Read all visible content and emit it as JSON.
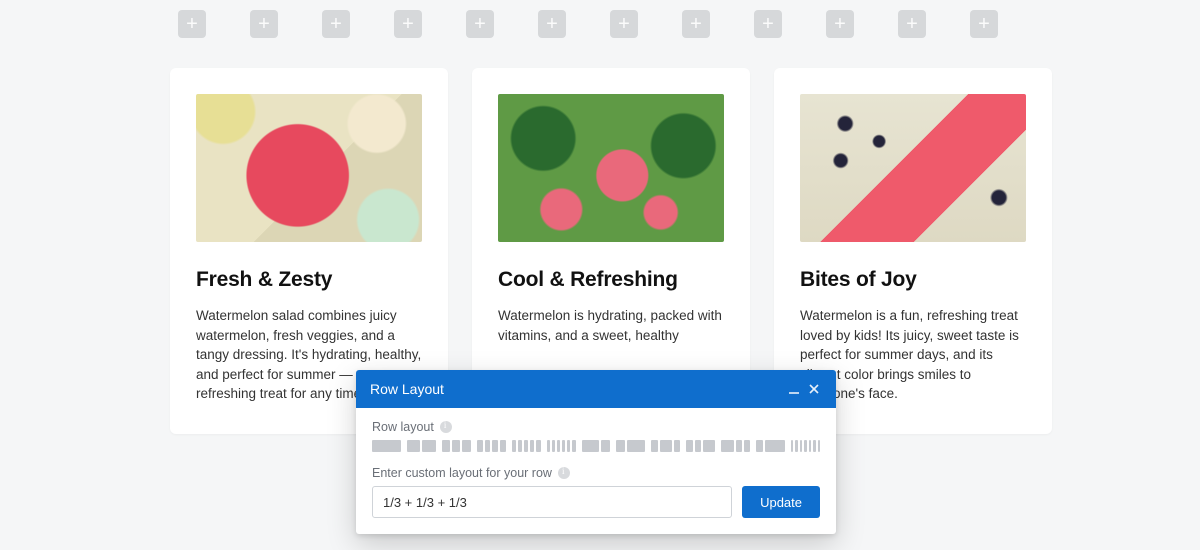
{
  "placeholders": {
    "count": 12,
    "glyph": "+"
  },
  "cards": [
    {
      "title": "Fresh & Zesty",
      "body": "Watermelon salad combines juicy watermelon, fresh veggies, and a tangy dressing. It's hydrating, healthy, and perfect for summer — a refreshing treat for any time."
    },
    {
      "title": "Cool & Refreshing",
      "body": "Watermelon is hydrating, packed with vitamins, and a sweet, healthy"
    },
    {
      "title": "Bites of Joy",
      "body": "Watermelon is a fun, refreshing treat loved by kids! Its juicy, sweet taste is perfect for summer days, and its vibrant color brings smiles to everyone's face."
    }
  ],
  "dialog": {
    "title": "Row Layout",
    "row_layout_label": "Row layout",
    "custom_label": "Enter custom layout for your row",
    "custom_value": "1/3 + 1/3 + 1/3",
    "update_label": "Update",
    "layout_options": [
      [
        1
      ],
      [
        1,
        1
      ],
      [
        1,
        1,
        1
      ],
      [
        1,
        1,
        1,
        1
      ],
      [
        1,
        1,
        1,
        1,
        1
      ],
      [
        1,
        1,
        1,
        1,
        1,
        1
      ],
      [
        2,
        1
      ],
      [
        1,
        2
      ],
      [
        1,
        2,
        1
      ],
      [
        1,
        1,
        2
      ],
      [
        2,
        1,
        1
      ],
      [
        1,
        3
      ],
      [
        1,
        1,
        1,
        1,
        1,
        1,
        1
      ]
    ]
  }
}
